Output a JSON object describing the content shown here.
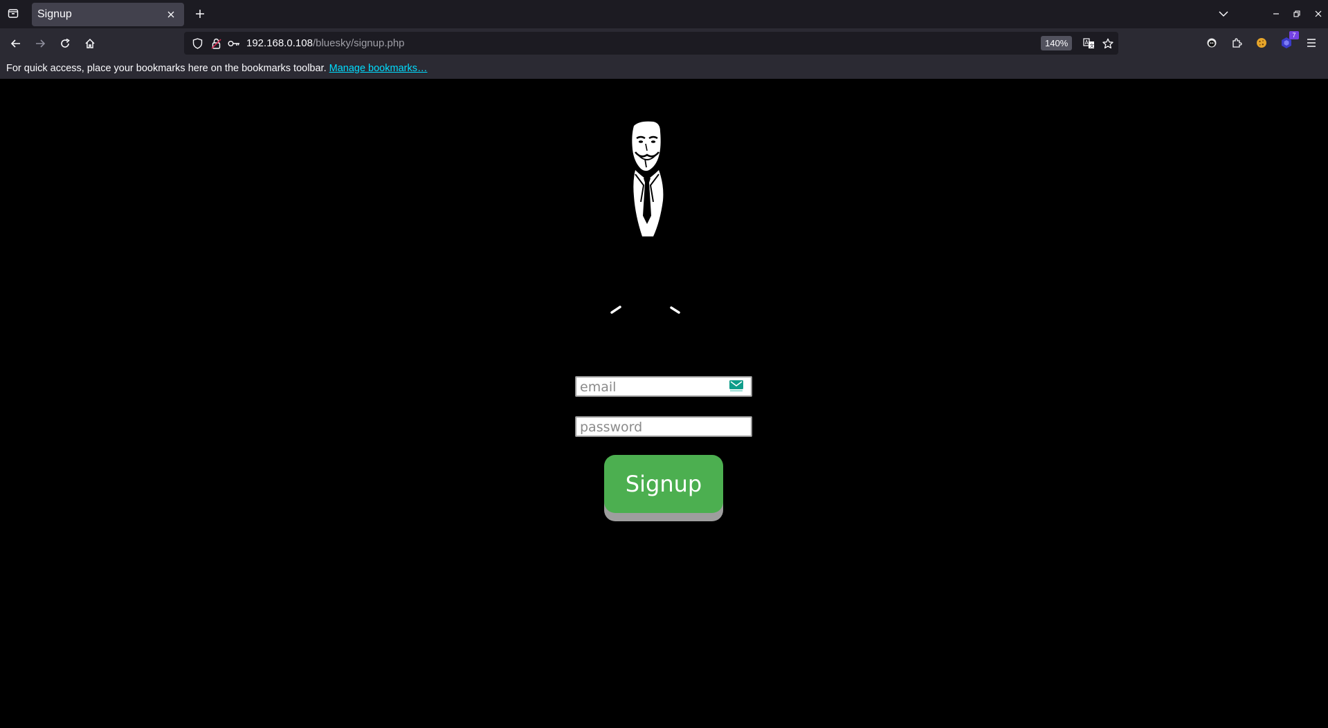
{
  "browser": {
    "tab": {
      "title": "Signup"
    },
    "url": {
      "host": "192.168.0.108",
      "path": "/bluesky/signup.php"
    },
    "zoom": "140%",
    "extension_badge_count": "7",
    "bookmarks": {
      "message": "For quick access, place your bookmarks here on the bookmarks toolbar.",
      "manage_link": "Manage bookmarks…"
    }
  },
  "page": {
    "email_placeholder": "email",
    "password_placeholder": "password",
    "signup_label": "Signup"
  },
  "colors": {
    "page_background": "#000000",
    "signup_button": "#4caf50",
    "signup_button_shadow": "#9e9e9e",
    "link": "#00ddff"
  },
  "icons": [
    "tab-list-icon",
    "close-icon",
    "plus-icon",
    "chevron-down-icon",
    "minimize-icon",
    "maximize-icon",
    "window-close-icon",
    "back-arrow-icon",
    "forward-arrow-icon",
    "reload-icon",
    "home-icon",
    "shield-icon",
    "lock-icon",
    "key-icon",
    "translate-icon",
    "star-icon",
    "extension-icon",
    "puzzle-icon",
    "cookie-icon",
    "hamburger-menu-icon",
    "anonymous-mask-logo",
    "loading-spinner-icon",
    "mail-icon"
  ]
}
